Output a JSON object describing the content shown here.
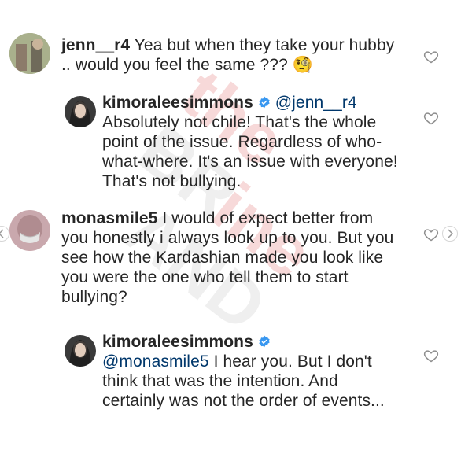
{
  "comments": [
    {
      "username": "jenn__r4",
      "mention": "",
      "text": "Yea but when they take your hubby .. would you feel the same ???",
      "emoji": "🧐",
      "verified": false
    },
    {
      "username": "kimoraleesimmons",
      "mention": "@jenn__r4",
      "text": "Absolutely not chile! That's the whole point of the issue. Regardless of who-what-where. It's an issue with everyone! That's not bullying.",
      "verified": true
    },
    {
      "username": "monasmile5",
      "mention": "",
      "text": "I would of expect better from you honestly i always look up to you. But you see how the Kardashian made you look like you were the one who tell them to start bullying?",
      "verified": false
    },
    {
      "username": "kimoraleesimmons",
      "mention": "@monasmile5",
      "text": "I hear you. But I don't think that was the intention. And certainly was not the order of events...",
      "verified": true
    }
  ],
  "colors": {
    "text": "#262626",
    "verified": "#3897f0",
    "heart_stroke": "#8e8e8e",
    "watermark": "#f2a4a4"
  },
  "icons": [
    "heart-outline-icon",
    "verified-badge-icon",
    "chevron-left-icon",
    "chevron-right-icon"
  ]
}
